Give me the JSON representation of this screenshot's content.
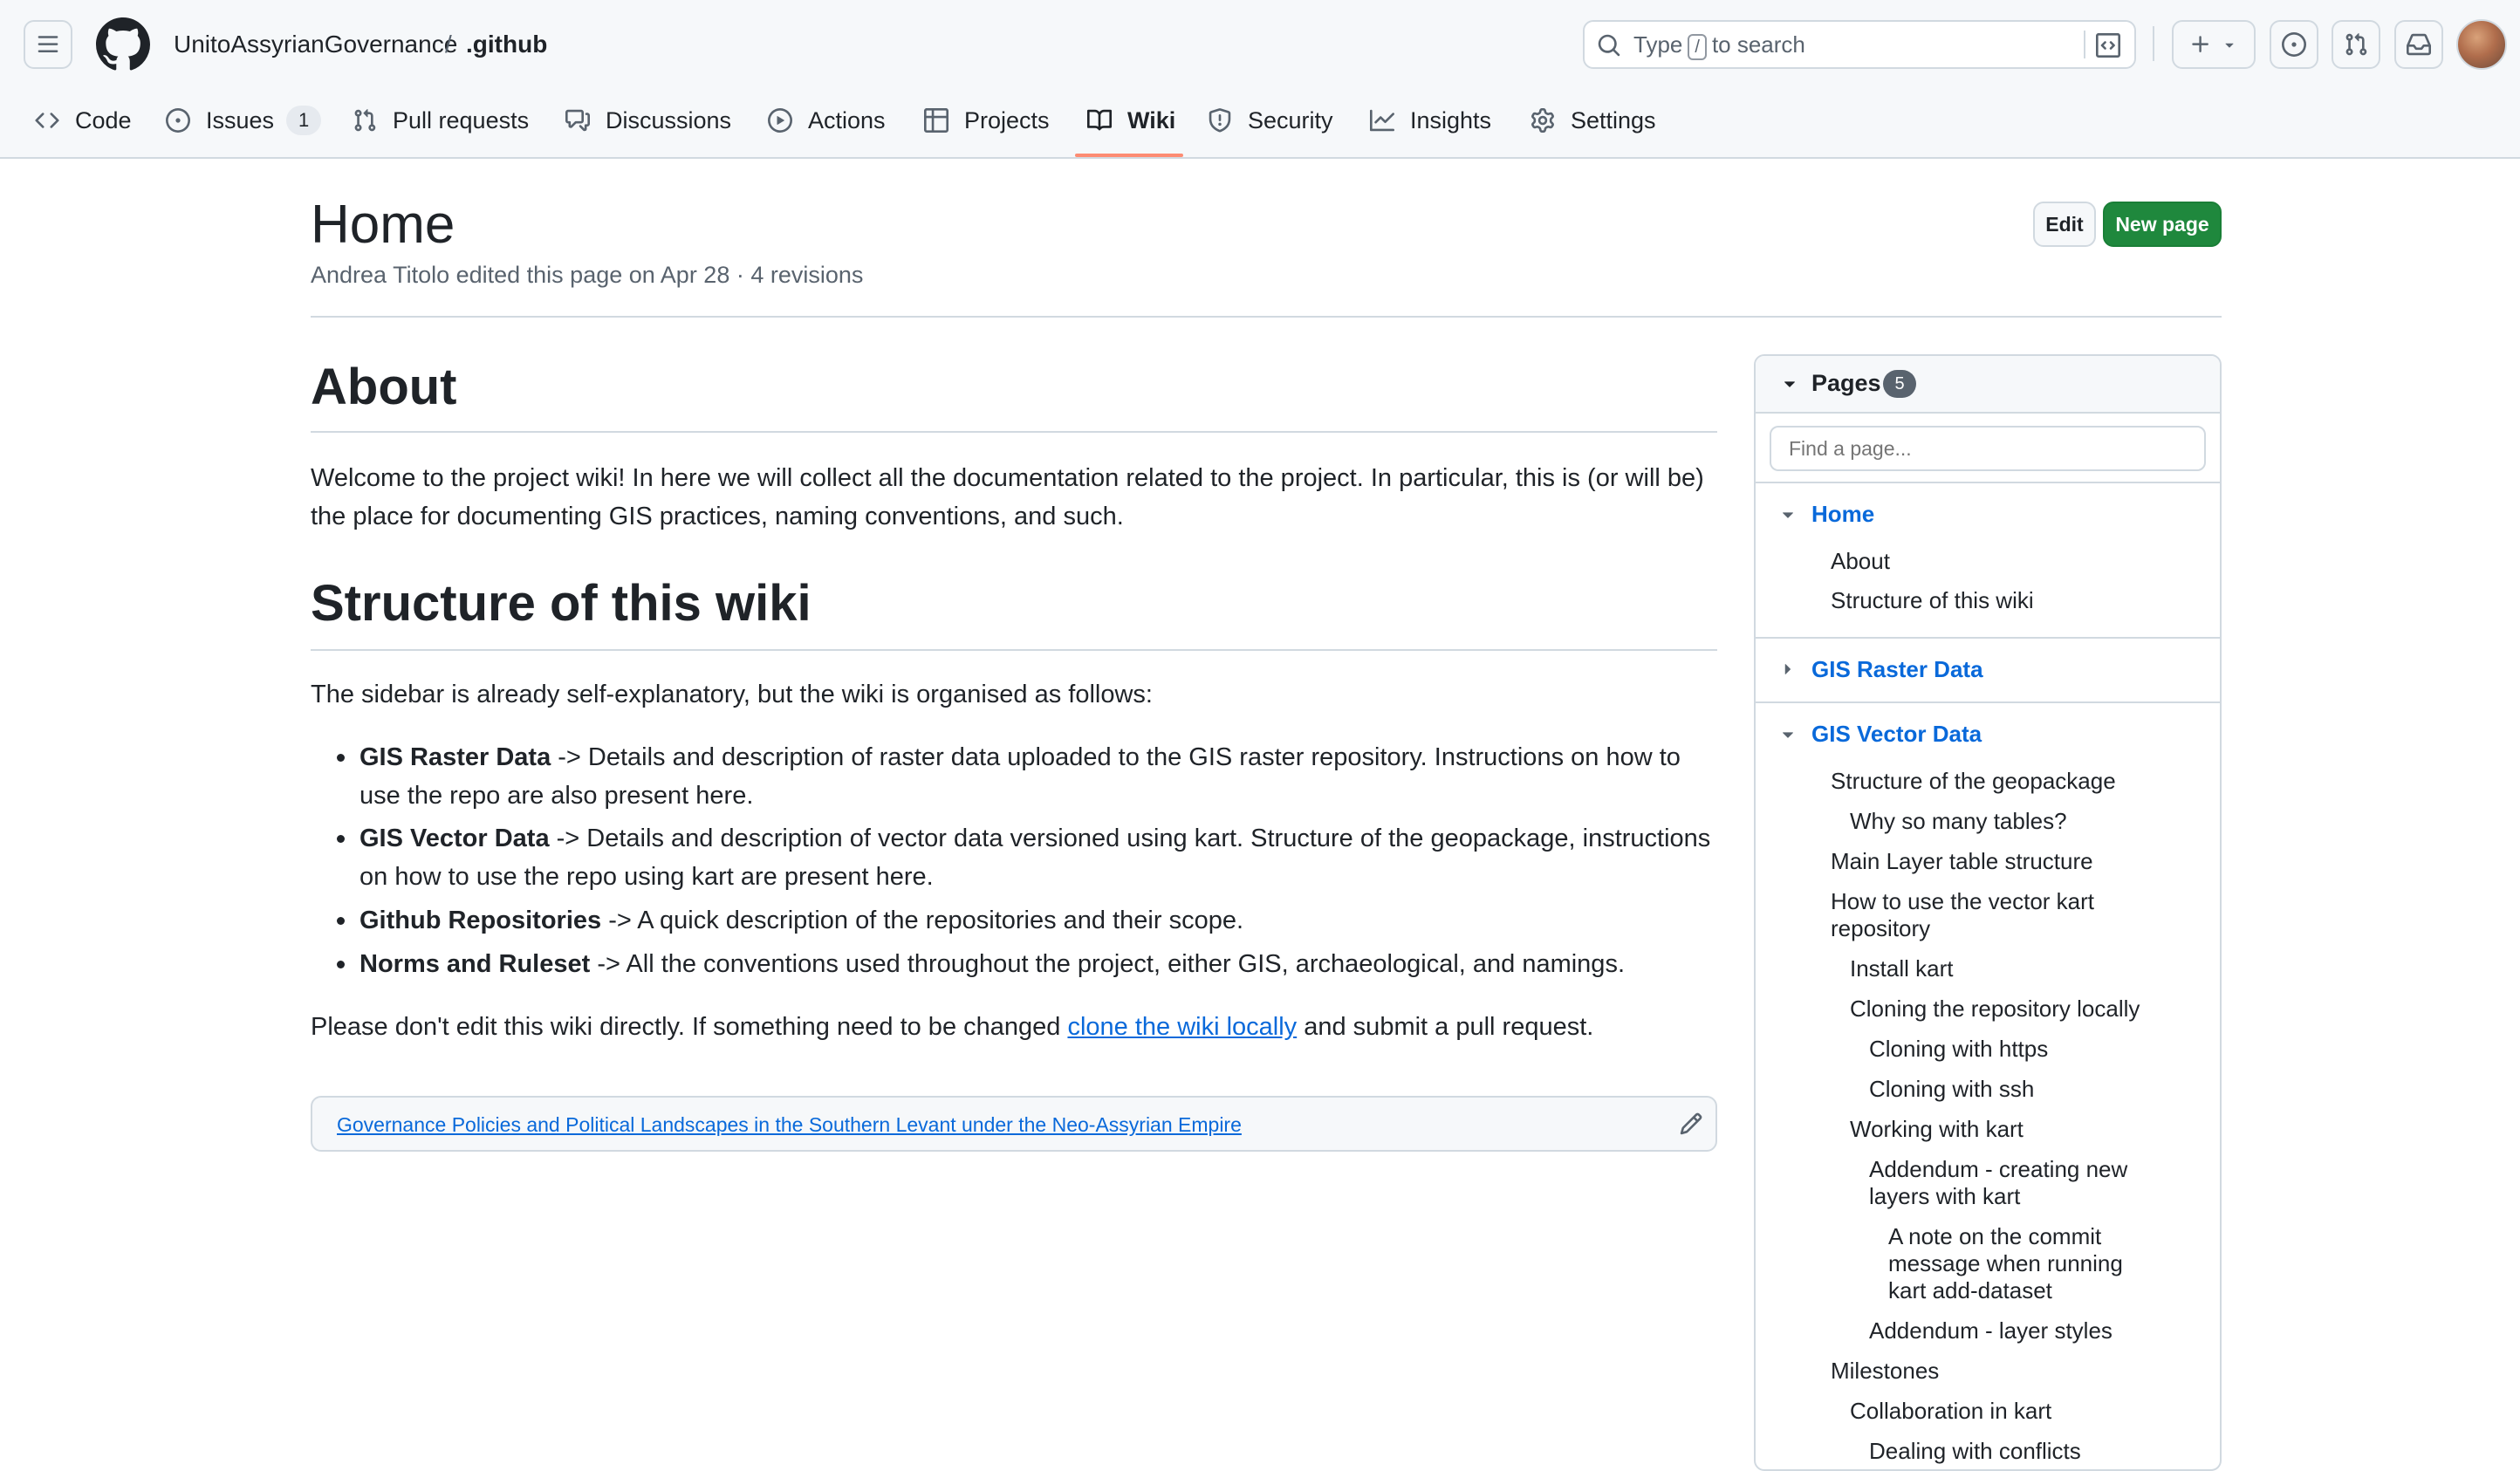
{
  "header": {
    "owner": "UnitoAssyrianGovernance",
    "separator": "/",
    "repo": ".github",
    "search_prefix": "Type",
    "search_key": "/",
    "search_suffix": "to search"
  },
  "nav": {
    "items": [
      {
        "label": "Code",
        "icon": "code-icon"
      },
      {
        "label": "Issues",
        "icon": "issue-opened-icon",
        "count": "1"
      },
      {
        "label": "Pull requests",
        "icon": "git-pull-request-icon"
      },
      {
        "label": "Discussions",
        "icon": "comment-discussion-icon"
      },
      {
        "label": "Actions",
        "icon": "play-icon"
      },
      {
        "label": "Projects",
        "icon": "table-icon"
      },
      {
        "label": "Wiki",
        "icon": "book-icon",
        "selected": true
      },
      {
        "label": "Security",
        "icon": "shield-icon"
      },
      {
        "label": "Insights",
        "icon": "graph-icon"
      },
      {
        "label": "Settings",
        "icon": "gear-icon"
      }
    ]
  },
  "page": {
    "title": "Home",
    "meta": "Andrea Titolo edited this page on Apr 28 · 4 revisions",
    "edit_label": "Edit",
    "new_page_label": "New page"
  },
  "content": {
    "h_about": "About",
    "p_welcome": "Welcome to the project wiki! In here we will collect all the documentation related to the project. In particular, this is (or will be) the place for documenting GIS practices, naming conventions, and such.",
    "h_structure": "Structure of this wiki",
    "p_sidebar": "The sidebar is already self-explanatory, but the wiki is organised as follows:",
    "list": [
      {
        "term": "GIS Raster Data",
        "text": " -> Details and description of raster data uploaded to the GIS raster repository. Instructions on how to use the repo are also present here."
      },
      {
        "term": "GIS Vector Data",
        "text": " -> Details and description of vector data versioned using kart. Structure of the geopackage, instructions on how to use the repo using kart are present here."
      },
      {
        "term": "Github Repositories",
        "text": " -> A quick description of the repositories and their scope."
      },
      {
        "term": "Norms and Ruleset",
        "text": " -> All the conventions used throughout the project, either GIS, archaeological, and namings."
      }
    ],
    "p_edit_before": "Please don't edit this wiki directly. If something need to be changed ",
    "p_edit_link": "clone the wiki locally",
    "p_edit_after": " and submit a pull request.",
    "footer_link": "Governance Policies and Political Landscapes in the Southern Levant under the Neo-Assyrian Empire"
  },
  "sidebar": {
    "title": "Pages",
    "count": "5",
    "find_placeholder": "Find a page...",
    "home": "Home",
    "home_items": [
      "About",
      "Structure of this wiki"
    ],
    "raster": "GIS Raster Data",
    "vector": "GIS Vector Data",
    "vector_items": [
      "Structure of the geopackage",
      "Why so many tables?",
      "Main Layer table structure",
      "How to use the vector kart",
      "repository",
      "Install kart",
      "Cloning the repository locally",
      "Cloning with https",
      "Cloning with ssh",
      "Working with kart",
      "Addendum - creating new",
      "layers with kart",
      "A note on the commit",
      "message when running",
      "kart add-dataset",
      "Addendum - layer styles",
      "Milestones",
      "Collaboration in kart",
      "Dealing with conflicts"
    ]
  },
  "colors": {
    "accent": "#0969da",
    "primary_button": "#1f883d",
    "selected_underline": "#fd8c73"
  }
}
